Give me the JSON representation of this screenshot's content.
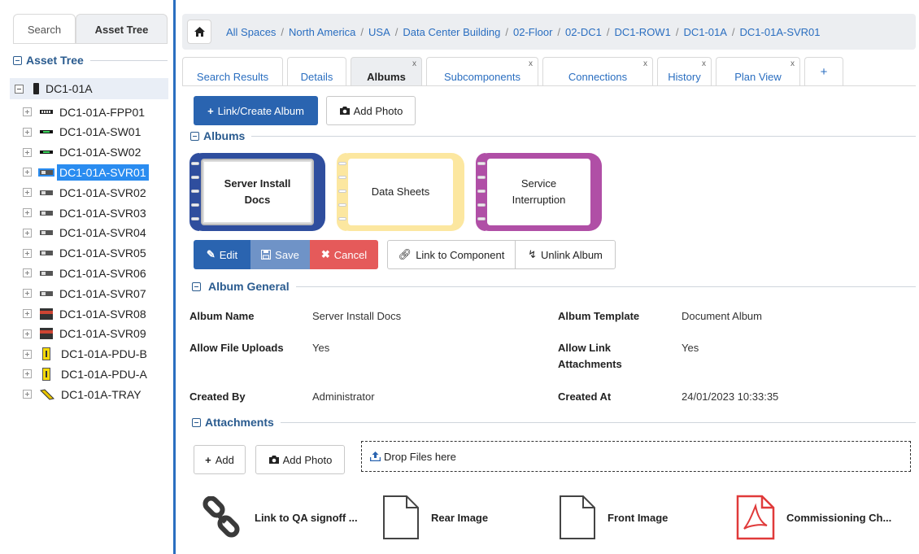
{
  "left": {
    "tabs": {
      "search": "Search",
      "tree": "Asset Tree"
    },
    "section": "Asset Tree",
    "root": "DC1-01A",
    "items": [
      {
        "label": "DC1-01A-FPP01",
        "icon": "patch-panel-icon"
      },
      {
        "label": "DC1-01A-SW01",
        "icon": "switch-icon"
      },
      {
        "label": "DC1-01A-SW02",
        "icon": "switch-icon"
      },
      {
        "label": "DC1-01A-SVR01",
        "icon": "server-icon",
        "selected": true
      },
      {
        "label": "DC1-01A-SVR02",
        "icon": "server-icon"
      },
      {
        "label": "DC1-01A-SVR03",
        "icon": "server-icon"
      },
      {
        "label": "DC1-01A-SVR04",
        "icon": "server-icon"
      },
      {
        "label": "DC1-01A-SVR05",
        "icon": "server-icon"
      },
      {
        "label": "DC1-01A-SVR06",
        "icon": "server-icon"
      },
      {
        "label": "DC1-01A-SVR07",
        "icon": "server-icon"
      },
      {
        "label": "DC1-01A-SVR08",
        "icon": "server-tall-icon"
      },
      {
        "label": "DC1-01A-SVR09",
        "icon": "server-tall-icon"
      },
      {
        "label": "DC1-01A-PDU-B",
        "icon": "pdu-icon"
      },
      {
        "label": "DC1-01A-PDU-A",
        "icon": "pdu-icon"
      },
      {
        "label": "DC1-01A-TRAY",
        "icon": "tray-icon"
      }
    ]
  },
  "breadcrumb": [
    "All Spaces",
    "North America",
    "USA",
    "Data Center Building",
    "02-Floor",
    "02-DC1",
    "DC1-ROW1",
    "DC1-01A",
    "DC1-01A-SVR01"
  ],
  "tabs": [
    {
      "label": "Search Results",
      "close": ""
    },
    {
      "label": "Details",
      "close": ""
    },
    {
      "label": "Albums",
      "close": "x",
      "active": true
    },
    {
      "label": "Subcomponents",
      "close": "x"
    },
    {
      "label": "Connections",
      "close": "x"
    },
    {
      "label": "History",
      "close": "x"
    },
    {
      "label": "Plan View",
      "close": "x"
    },
    {
      "label": "+",
      "close": ""
    }
  ],
  "toolbar": {
    "link_create": "Link/Create Album",
    "add_photo": "Add Photo"
  },
  "albums_section": "Albums",
  "albums": [
    {
      "name": "Server Install Docs",
      "color": "#2f4e9e"
    },
    {
      "name": "Data Sheets",
      "color": "#fce7a0"
    },
    {
      "name": "Service Interruption",
      "color": "#b04fa6"
    }
  ],
  "album_actions": {
    "edit": "Edit",
    "save": "Save",
    "cancel": "Cancel",
    "link": "Link to Component",
    "unlink": "Unlink Album"
  },
  "general": {
    "title": "Album General",
    "album_name_label": "Album Name",
    "album_name": "Server Install Docs",
    "template_label": "Album Template",
    "template": "Document Album",
    "uploads_label": "Allow File Uploads",
    "uploads": "Yes",
    "link_att_label_1": "Allow Link",
    "link_att_label_2": "Attachments",
    "link_att": "Yes",
    "created_by_label": "Created By",
    "created_by": "Administrator",
    "created_at_label": "Created At",
    "created_at": "24/01/2023 10:33:35"
  },
  "attachments": {
    "title": "Attachments",
    "add": "Add",
    "add_photo": "Add Photo",
    "drop": "Drop Files here",
    "items": [
      {
        "name": "Link to QA signoff ...",
        "icon": "link-icon"
      },
      {
        "name": "Rear Image",
        "icon": "file-icon"
      },
      {
        "name": "Front Image",
        "icon": "file-icon"
      },
      {
        "name": "Commissioning Ch...",
        "icon": "pdf-icon"
      }
    ]
  }
}
